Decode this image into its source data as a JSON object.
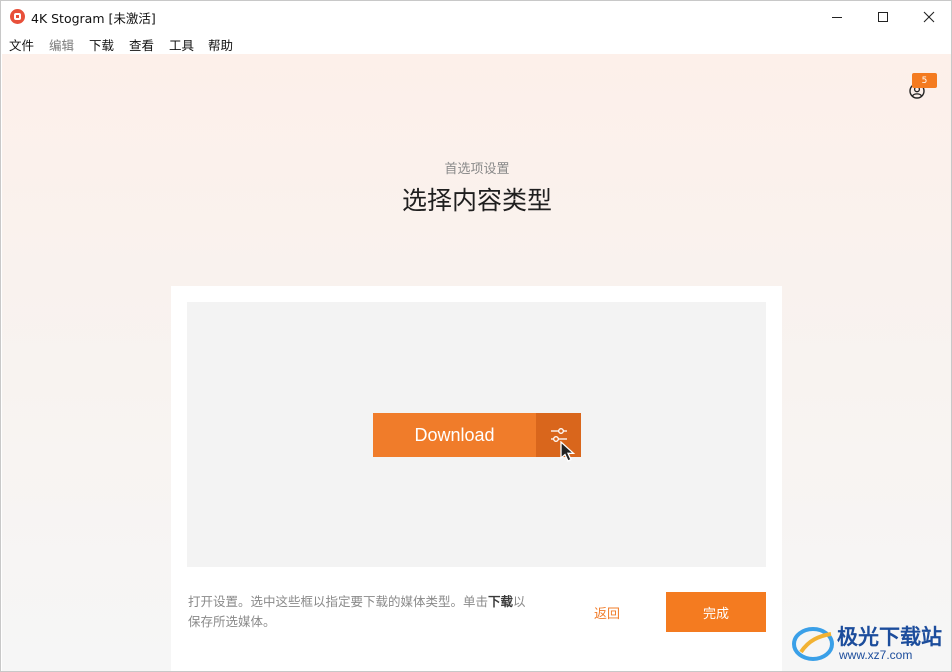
{
  "window": {
    "title": "4K Stogram [未激活]"
  },
  "menu": [
    {
      "label": "文件",
      "enabled": true
    },
    {
      "label": "编辑",
      "enabled": false
    },
    {
      "label": "下载",
      "enabled": true
    },
    {
      "label": "查看",
      "enabled": true
    },
    {
      "label": "工具",
      "enabled": true
    },
    {
      "label": "帮助",
      "enabled": true
    }
  ],
  "account": {
    "icon": "user-circle-icon",
    "badge": "5"
  },
  "page": {
    "subtitle": "首选项设置",
    "heading": "选择内容类型"
  },
  "preview": {
    "download_label": "Download",
    "settings_icon": "sliders-icon"
  },
  "footer": {
    "hint_part1": "打开设置。选中这些框以指定要下载的媒体类型。单击",
    "hint_bold": "下载",
    "hint_part2": "以保存所选媒体。",
    "back_label": "返回",
    "done_label": "完成"
  },
  "watermark": {
    "text": "极光下载站",
    "url": "www.xz7.com"
  },
  "colors": {
    "accent": "#f47b20",
    "accent_dark": "#d9661c",
    "watermark": "#1c4d9c"
  }
}
